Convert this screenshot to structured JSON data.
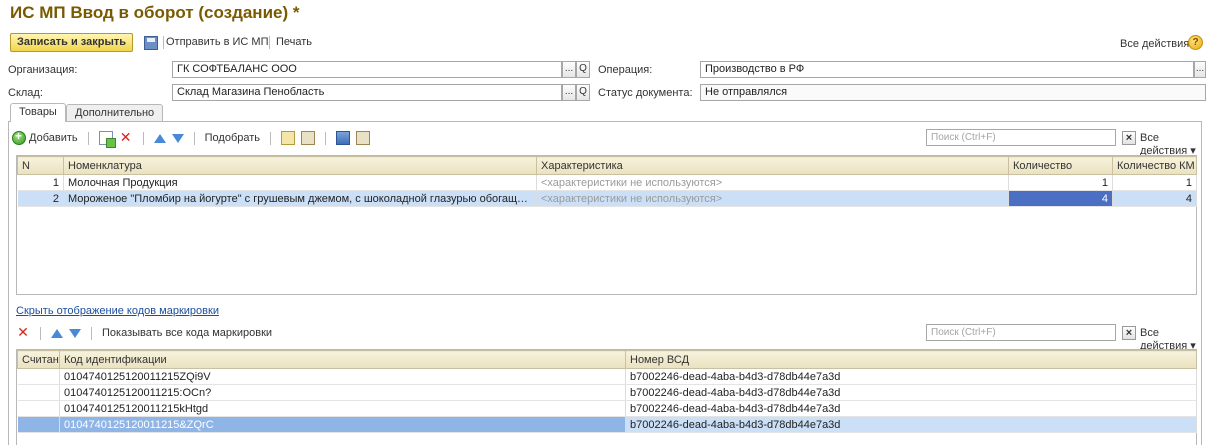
{
  "window": {
    "title": "ИС МП Ввод в оборот (создание) *"
  },
  "toolbar": {
    "save_close": "Записать и закрыть",
    "send": "Отправить в ИС МП",
    "print": "Печать",
    "all_actions": "Все действия ▾",
    "help": "?"
  },
  "form": {
    "org_label": "Организация:",
    "org_value": "ГК СОФТБАЛАНС ООО",
    "warehouse_label": "Склад:",
    "warehouse_value": "Склад Магазина Пенобласть",
    "operation_label": "Операция:",
    "operation_value": "Производство в РФ",
    "status_label": "Статус документа:",
    "status_value": "Не отправлялся",
    "pick_btn": "...",
    "search_btn": "Q"
  },
  "tabs": [
    {
      "label": "Товары",
      "active": true
    },
    {
      "label": "Дополнительно",
      "active": false
    }
  ],
  "goods_toolbar": {
    "add": "Добавить",
    "pick": "Подобрать",
    "search_placeholder": "Поиск (Ctrl+F)",
    "clear": "×",
    "all_actions": "Все действия ▾"
  },
  "goods_table": {
    "columns": [
      "N",
      "Номенклатура",
      "Характеристика",
      "Количество",
      "Количество КМ"
    ],
    "rows": [
      {
        "n": "1",
        "name": "Молочная Продукция",
        "char": "<характеристики не используются>",
        "qty": "1",
        "qty_km": "1"
      },
      {
        "n": "2",
        "name": "Мороженое \"Пломбир на йогурте\" с грушевым джемом, с шоколадной глазурью обогащенный...",
        "char": "<характеристики не используются>",
        "qty": "4",
        "qty_km": "4"
      }
    ]
  },
  "codes_link": "Скрыть отображение кодов маркировки",
  "codes_toolbar": {
    "show_all": "Показывать все кода маркировки",
    "search_placeholder": "Поиск (Ctrl+F)",
    "clear": "×",
    "all_actions": "Все действия ▾"
  },
  "codes_table": {
    "columns": [
      "Считан",
      "Код идентификации",
      "Номер ВСД"
    ],
    "rows": [
      {
        "read": "",
        "code": "0104740125120011215ZQi9V",
        "vsd": "b7002246-dead-4aba-b4d3-d78db44e7a3d"
      },
      {
        "read": "",
        "code": "0104740125120011215:OCn?",
        "vsd": "b7002246-dead-4aba-b4d3-d78db44e7a3d"
      },
      {
        "read": "",
        "code": "0104740125120011215kHtgd",
        "vsd": "b7002246-dead-4aba-b4d3-d78db44e7a3d"
      },
      {
        "read": "",
        "code": "0104740125120011215&ZQrC",
        "vsd": "b7002246-dead-4aba-b4d3-d78db44e7a3d"
      }
    ]
  }
}
